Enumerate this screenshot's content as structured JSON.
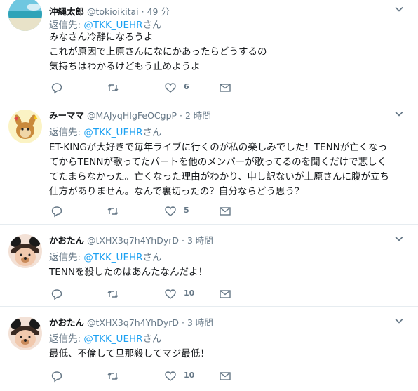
{
  "tweets": [
    {
      "name": "沖縄太郎",
      "handle": "@tokioikitai",
      "dot": "·",
      "time": "49 分",
      "reply_prefix": "返信先:",
      "reply_to": "@TKK_UEHR",
      "reply_suffix": "さん",
      "lines": [
        "みなさん冷静になろうよ",
        "これが原因で上原さんになにかあったらどうするの",
        "気持ちはわかるけどもう止めようよ"
      ],
      "like_count": "6"
    },
    {
      "name": "みーママ",
      "handle": "@MAJyqHIgFeOCgpP",
      "dot": "·",
      "time": "2 時間",
      "reply_prefix": "返信先:",
      "reply_to": "@TKK_UEHR",
      "reply_suffix": "さん",
      "lines": [
        "ET-KINGが大好きで毎年ライブに行くのが私の楽しみでした！TENNが亡くなっ",
        "てからTENNが歌ってたパートを他のメンバーが歌ってるのを聞くだけで悲しく",
        "てたまらなかった。亡くなった理由がわかり、申し訳ないが上原さんに腹が立ち",
        "仕方がありません。なんで裏切ったの？自分ならどう思う？"
      ],
      "like_count": "5"
    },
    {
      "name": "かおたん",
      "handle": "@tXHX3q7h4YhDyrD",
      "dot": "·",
      "time": "3 時間",
      "reply_prefix": "返信先:",
      "reply_to": "@TKK_UEHR",
      "reply_suffix": "さん",
      "lines": [
        "TENNを殺したのはあんたなんだよ！"
      ],
      "like_count": "10"
    },
    {
      "name": "かおたん",
      "handle": "@tXHX3q7h4YhDyrD",
      "dot": "·",
      "time": "3 時間",
      "reply_prefix": "返信先:",
      "reply_to": "@TKK_UEHR",
      "reply_suffix": "さん",
      "lines": [
        "最低、不倫して旦那殺してマジ最低！"
      ],
      "like_count": "10"
    }
  ],
  "colors": {
    "accent": "#1da1f2",
    "muted": "#657786",
    "text": "#14171a",
    "divider": "#e6ecf0"
  },
  "icons": [
    "reply-icon",
    "retweet-icon",
    "like-icon",
    "message-icon",
    "chevron-down-icon"
  ]
}
